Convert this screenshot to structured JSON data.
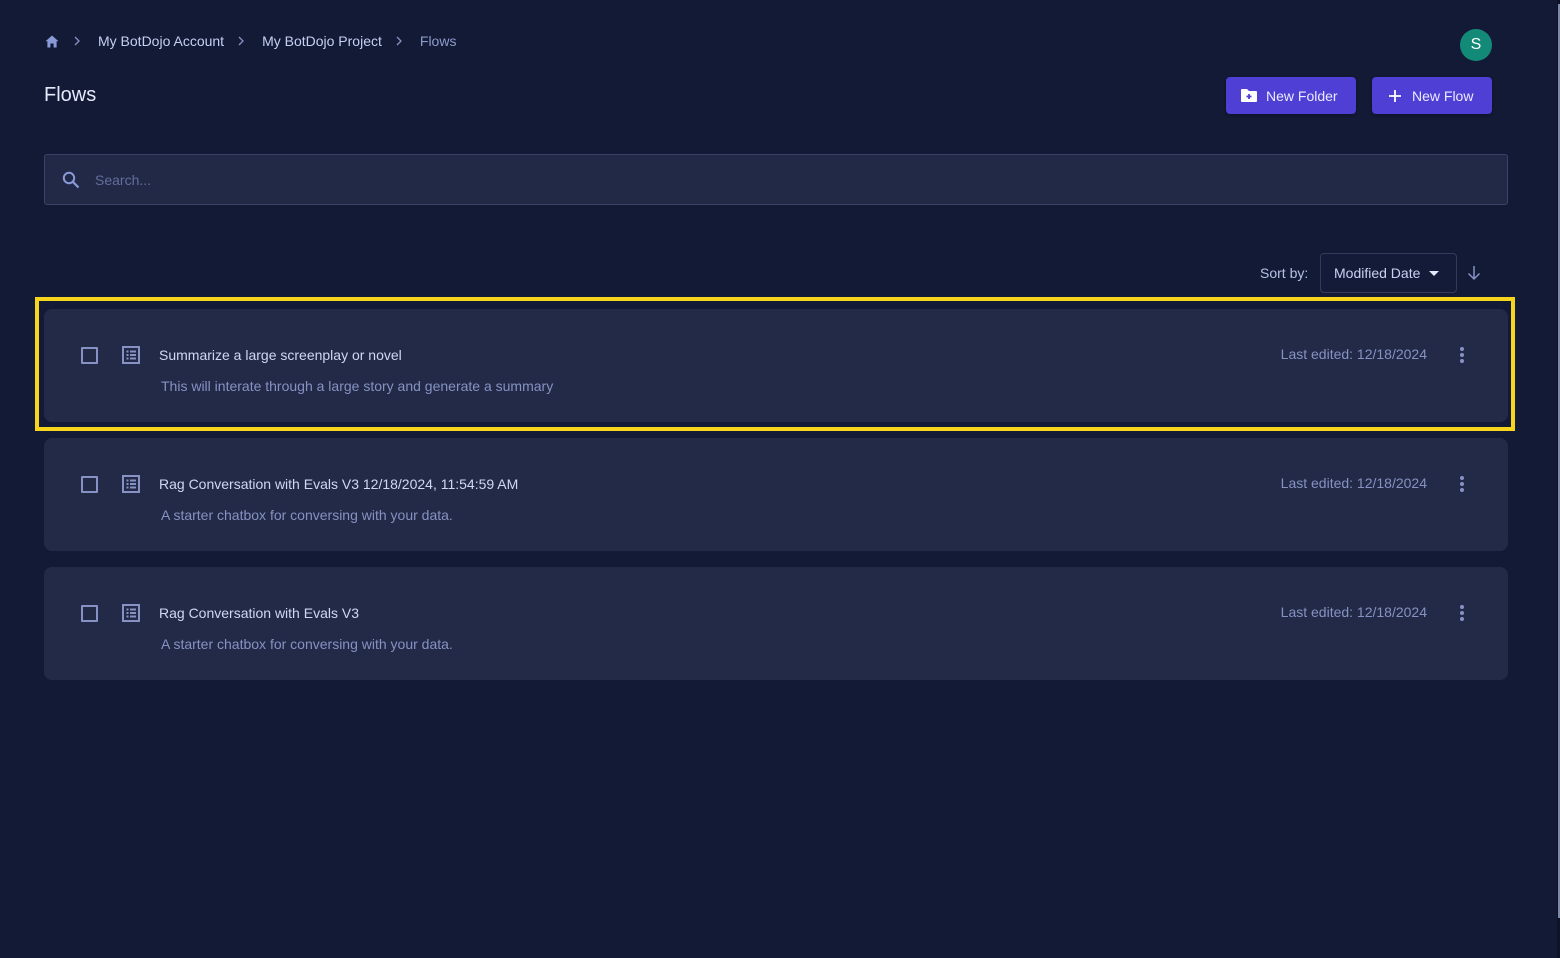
{
  "breadcrumb": {
    "home_icon": "home-icon",
    "separator_icon": "chevron-right-icon",
    "items": [
      {
        "label": "My BotDojo Account"
      },
      {
        "label": "My BotDojo Project"
      },
      {
        "label": "Flows"
      }
    ]
  },
  "header": {
    "title": "Flows",
    "avatar_initial": "S",
    "avatar_color": "#138a78"
  },
  "toolbar": {
    "new_folder_label": "New Folder",
    "new_folder_icon": "folder-plus-icon",
    "new_flow_label": "New Flow",
    "new_flow_icon": "plus-icon",
    "accent_color": "#4f3fd4"
  },
  "search": {
    "placeholder": "Search...",
    "value": "",
    "icon": "search-icon"
  },
  "sort": {
    "label": "Sort by:",
    "selected": "Modified Date",
    "direction": "descending",
    "direction_icon": "arrow-down-icon"
  },
  "flows": [
    {
      "title": "Summarize a large screenplay or novel",
      "description": "This will interate through a large story and generate a summary",
      "last_edited": "Last edited: 12/18/2024",
      "checked": false,
      "highlighted": true
    },
    {
      "title": "Rag Conversation with Evals V3 12/18/2024, 11:54:59 AM",
      "description": "A starter chatbox for conversing with your data.",
      "last_edited": "Last edited: 12/18/2024",
      "checked": false,
      "highlighted": false
    },
    {
      "title": "Rag Conversation with Evals V3",
      "description": "A starter chatbox for conversing with your data.",
      "last_edited": "Last edited: 12/18/2024",
      "checked": false,
      "highlighted": false
    }
  ],
  "highlight_color": "#f7d51d"
}
